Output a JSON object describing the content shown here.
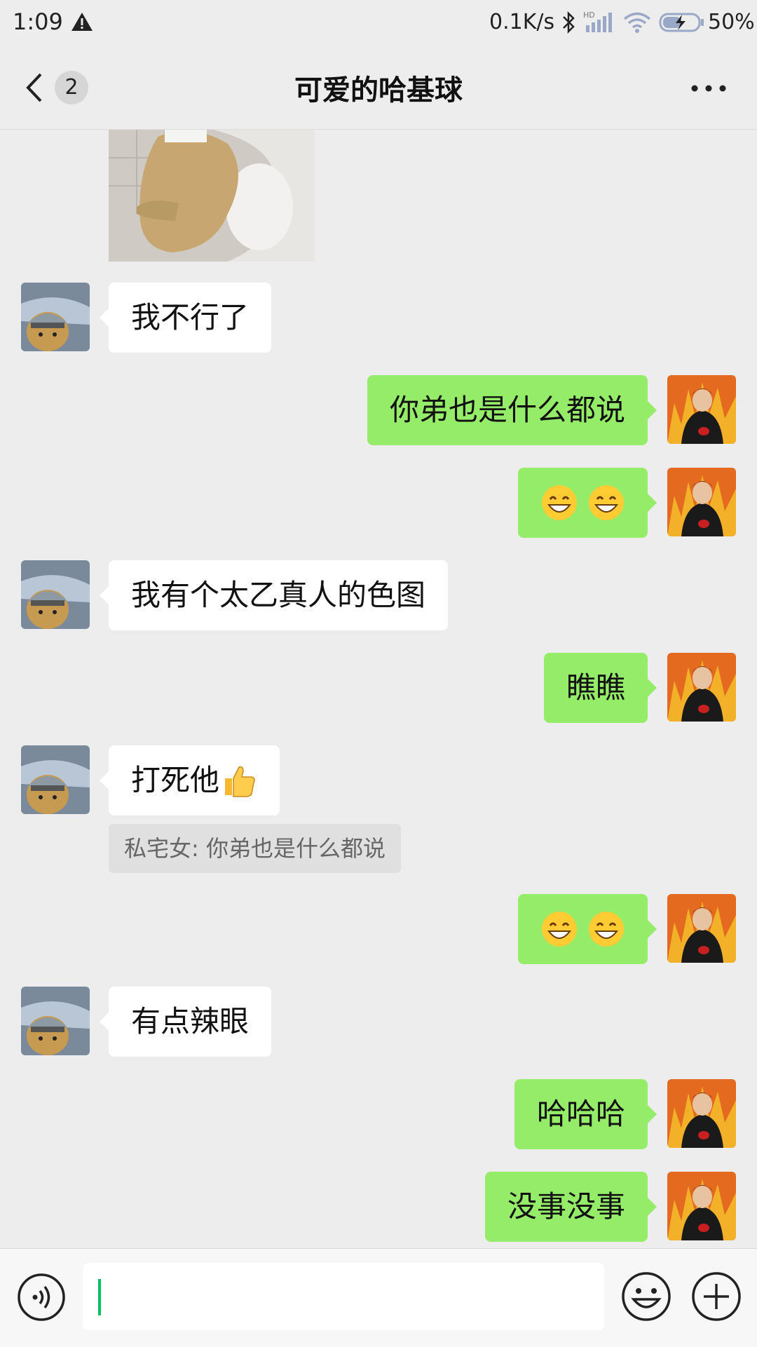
{
  "status_bar": {
    "time": "1:09",
    "net_speed": "0.1K/s",
    "battery": "50%",
    "icons": [
      "alert-icon",
      "bluetooth-icon",
      "hd-signal-icon",
      "wifi-icon",
      "battery-charging-icon"
    ]
  },
  "header": {
    "unread_count": "2",
    "title": "可爱的哈基球",
    "back_icon": "chevron-left-icon",
    "more_icon": "more-dots-icon"
  },
  "messages": [
    {
      "side": "left",
      "type": "image",
      "icon": "dog-photo"
    },
    {
      "side": "left",
      "type": "text",
      "text": "我不行了"
    },
    {
      "side": "right",
      "type": "text",
      "text": "你弟也是什么都说"
    },
    {
      "side": "right",
      "type": "emoji",
      "emojis": [
        "grin-emoji",
        "grin-emoji"
      ]
    },
    {
      "side": "left",
      "type": "text",
      "text": "我有个太乙真人的色图"
    },
    {
      "side": "right",
      "type": "text",
      "text": "瞧瞧"
    },
    {
      "side": "left",
      "type": "text",
      "text": "打死他",
      "emoji": "thumbs-up-emoji",
      "quote": "私宅女: 你弟也是什么都说"
    },
    {
      "side": "right",
      "type": "emoji",
      "emojis": [
        "grin-emoji",
        "grin-emoji"
      ]
    },
    {
      "side": "left",
      "type": "text",
      "text": "有点辣眼"
    },
    {
      "side": "right",
      "type": "text",
      "text": "哈哈哈"
    },
    {
      "side": "right",
      "type": "text",
      "text": "没事没事"
    }
  ],
  "input_bar": {
    "value": "",
    "voice_icon": "voice-icon",
    "emoji_icon": "smiley-icon",
    "plus_icon": "plus-icon"
  },
  "colors": {
    "background": "#ededed",
    "my_bubble": "#95ec69",
    "their_bubble": "#ffffff",
    "accent": "#07c160"
  }
}
